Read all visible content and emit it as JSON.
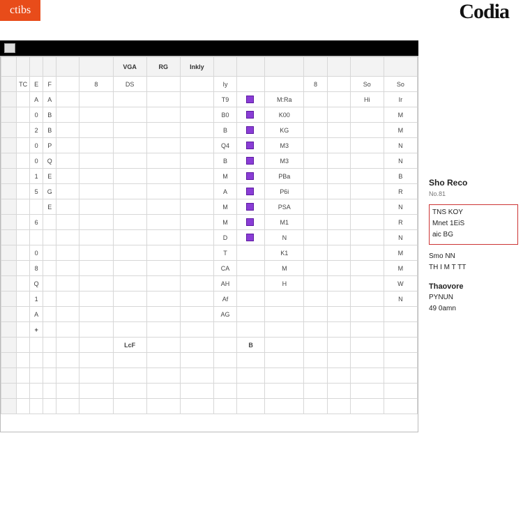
{
  "app": {
    "tag_label": "ctibs",
    "brand": "Codia"
  },
  "toolbar": {
    "icon_count": 1
  },
  "grid": {
    "columns": [
      "",
      "",
      "",
      "",
      "",
      "VGA",
      "RG",
      "Inkly",
      "",
      "",
      "",
      "",
      "",
      "",
      ""
    ],
    "rows": [
      {
        "n": "",
        "cells": [
          "TC",
          "E",
          "F",
          "",
          "8",
          "DS",
          "",
          "",
          "Iy",
          "",
          "",
          "8",
          "",
          "So",
          "So"
        ]
      },
      {
        "n": "",
        "cells": [
          "",
          "A",
          "A",
          "",
          "",
          "",
          "",
          "",
          "T9",
          "■",
          "M:Ra",
          "",
          "",
          "Hi",
          "Ir"
        ]
      },
      {
        "n": "",
        "cells": [
          "",
          "0",
          "B",
          "",
          "",
          "",
          "",
          "",
          "B0",
          "■",
          "K00",
          "",
          "",
          "",
          "M"
        ]
      },
      {
        "n": "",
        "cells": [
          "",
          "2",
          "B",
          "",
          "",
          "",
          "",
          "",
          "B",
          "■",
          "KG",
          "",
          "",
          "",
          "M"
        ]
      },
      {
        "n": "",
        "cells": [
          "",
          "0",
          "P",
          "",
          "",
          "",
          "",
          "",
          "Q4",
          "■",
          "M3",
          "",
          "",
          "",
          "N"
        ]
      },
      {
        "n": "",
        "cells": [
          "",
          "0",
          "Q",
          "",
          "",
          "",
          "",
          "",
          "B",
          "■",
          "M3",
          "",
          "",
          "",
          "N"
        ]
      },
      {
        "n": "",
        "cells": [
          "",
          "1",
          "E",
          "",
          "",
          "",
          "",
          "",
          "M",
          "■",
          "PBa",
          "",
          "",
          "",
          "B"
        ]
      },
      {
        "n": "",
        "cells": [
          "",
          "5",
          "G",
          "",
          "",
          "",
          "",
          "",
          "A",
          "■",
          "P6i",
          "",
          "",
          "",
          "R"
        ]
      },
      {
        "n": "",
        "cells": [
          "",
          "",
          "E",
          "",
          "",
          "",
          "",
          "",
          "M",
          "■",
          "PSA",
          "",
          "",
          "",
          "N"
        ]
      },
      {
        "n": "",
        "cells": [
          "",
          "6",
          "",
          "",
          "",
          "",
          "",
          "",
          "M",
          "■",
          "M1",
          "",
          "",
          "",
          "R"
        ]
      },
      {
        "n": "",
        "cells": [
          "",
          "",
          "",
          "",
          "",
          "",
          "",
          "",
          "D",
          "■",
          "N",
          "",
          "",
          "",
          "N"
        ]
      },
      {
        "n": "",
        "cells": [
          "",
          "0",
          "",
          "",
          "",
          "",
          "",
          "",
          "T",
          "",
          "K1",
          "",
          "",
          "",
          "M"
        ]
      },
      {
        "n": "",
        "cells": [
          "",
          "8",
          "",
          "",
          "",
          "",
          "",
          "",
          "CA",
          "",
          "M",
          "",
          "",
          "",
          "M"
        ]
      },
      {
        "n": "",
        "cells": [
          "",
          "Q",
          "",
          "",
          "",
          "",
          "",
          "",
          "AH",
          "",
          "H",
          "",
          "",
          "",
          "W"
        ]
      },
      {
        "n": "",
        "cells": [
          "",
          "1",
          "",
          "",
          "",
          "",
          "",
          "",
          "Af",
          "",
          "",
          "",
          "",
          "",
          "N"
        ]
      },
      {
        "n": "",
        "cells": [
          "",
          "A",
          "",
          "",
          "",
          "",
          "",
          "",
          "AG",
          "",
          "",
          "",
          "",
          "",
          ""
        ]
      },
      {
        "n": "",
        "cells": [
          "",
          "+",
          "",
          "",
          "",
          "",
          "",
          "",
          "",
          "",
          "",
          "",
          "",
          "",
          ""
        ],
        "accent": true
      },
      {
        "n": "",
        "cells": [
          "",
          "",
          "",
          "",
          "",
          "LcF",
          "",
          "",
          "",
          "B",
          "",
          "",
          "",
          "",
          ""
        ],
        "accent": true
      },
      {
        "n": "",
        "cells": [
          "",
          "",
          "",
          "",
          "",
          "",
          "",
          "",
          "",
          "",
          "",
          "",
          "",
          "",
          ""
        ]
      },
      {
        "n": "",
        "cells": [
          "",
          "",
          "",
          "",
          "",
          "",
          "",
          "",
          "",
          "",
          "",
          "",
          "",
          "",
          ""
        ]
      },
      {
        "n": "",
        "cells": [
          "",
          "",
          "",
          "",
          "",
          "",
          "",
          "",
          "",
          "",
          "",
          "",
          "",
          "",
          ""
        ]
      },
      {
        "n": "",
        "cells": [
          "",
          "",
          "",
          "",
          "",
          "",
          "",
          "",
          "",
          "",
          "",
          "",
          "",
          "",
          ""
        ]
      }
    ]
  },
  "panel": {
    "heading": "Sho Reco",
    "sub": "No.81",
    "box_lines": [
      "TNS KOY",
      "Mnet 1EiS",
      "aic   BG"
    ],
    "lines": [
      "Smo NN",
      "TH I M T TT"
    ],
    "section2_heading": "Thaovore",
    "section2_lines": [
      "PYNUN",
      "49 0amn"
    ]
  }
}
